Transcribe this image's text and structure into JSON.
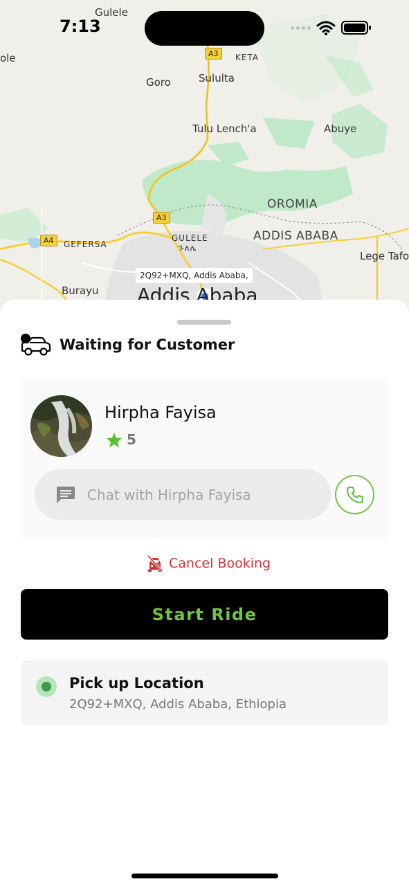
{
  "status_bar": {
    "time": "7:13"
  },
  "map": {
    "labels": {
      "gulele_top": "Gulele",
      "ole": "ole",
      "goro": "Goro",
      "sululta": "Sululta",
      "keta": "KETA",
      "tulu_lencha": "Tulu Lench'a",
      "abuye": "Abuye",
      "oromia": "OROMIA",
      "addis_ababa_region": "ADDIS ABABA",
      "gefersa": "GEFERSA",
      "gulele": "GULELE",
      "gulele_amharic": "ጉለሌ",
      "lege_tafo": "Lege Tafo",
      "burayu": "Burayu",
      "addis_ababa_city": "Addis Ababa"
    },
    "shields": {
      "a3_top": "A3",
      "a3_mid": "A3",
      "a4": "A4"
    },
    "pin_label": "2Q92+MXQ, Addis Ababa,"
  },
  "sheet": {
    "status_title": "Waiting for Customer",
    "driver": {
      "name": "Hirpha Fayisa",
      "rating": "5",
      "chat_placeholder": "Chat with Hirpha Fayisa"
    },
    "cancel_label": "Cancel Booking",
    "start_label": "Start Ride",
    "pickup": {
      "title": "Pick up Location",
      "address": "2Q92+MXQ, Addis Ababa, Ethiopia"
    }
  },
  "colors": {
    "accent_green": "#6cc93d",
    "cancel_red": "#d32f2f",
    "map_park": "#bfe9c9"
  },
  "icons": {
    "status": "car-waiting-icon",
    "rating": "star-icon",
    "chat": "chat-icon",
    "call": "phone-icon",
    "cancel": "car-cancel-icon",
    "pickup": "pickup-dot-icon"
  }
}
